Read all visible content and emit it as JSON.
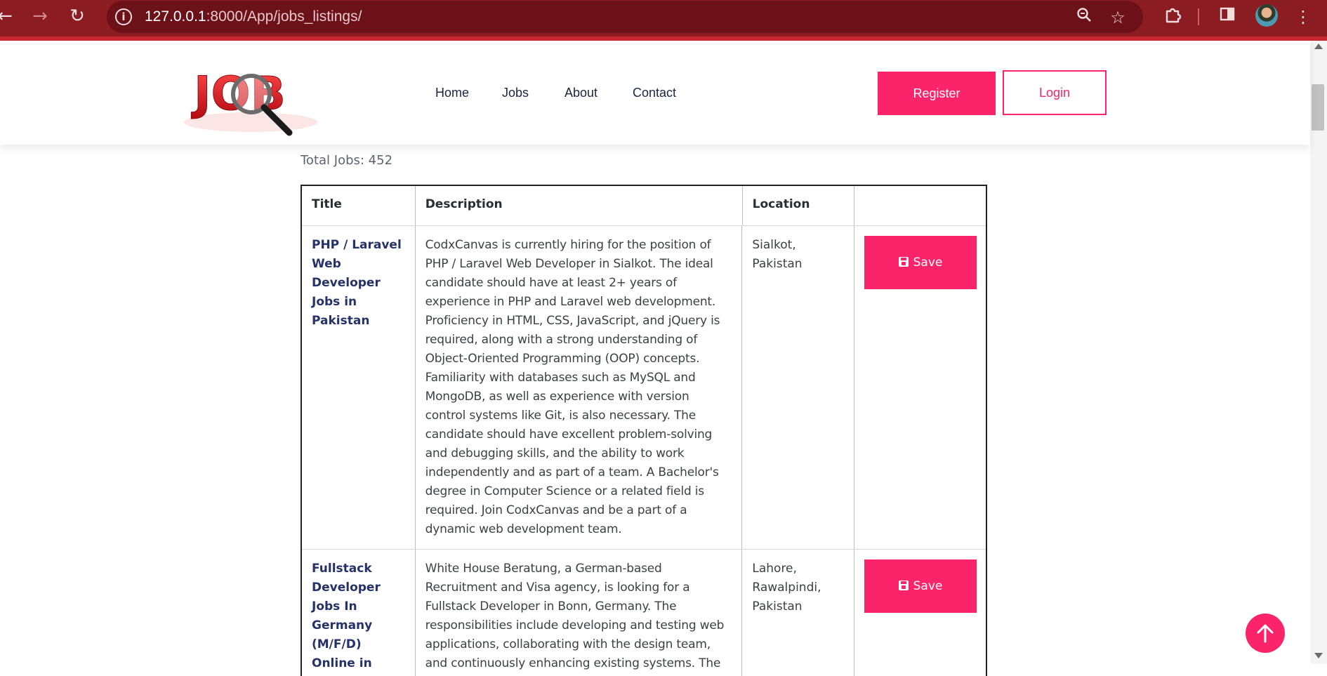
{
  "browser": {
    "url_host": "127.0.0.1",
    "url_path": ":8000/App/jobs_listings/",
    "icons": [
      "back-arrow-icon",
      "forward-arrow-icon",
      "reload-icon",
      "site-info-icon",
      "zoom-icon",
      "bookmark-star-icon",
      "extensions-icon",
      "side-panel-icon",
      "profile-avatar",
      "menu-dots-icon"
    ],
    "theme_color": "#8b1c22"
  },
  "header": {
    "logo_text": "JOB",
    "nav": [
      "Home",
      "Jobs",
      "About",
      "Contact"
    ],
    "register_label": "Register",
    "login_label": "Login",
    "accent_color": "#fb246a"
  },
  "listing": {
    "total_label": "Total Jobs: ",
    "total_count": "452",
    "columns": [
      "Title",
      "Description",
      "Location",
      ""
    ],
    "save_label": "Save",
    "jobs": [
      {
        "title": "PHP / Laravel Web Developer Jobs in Pakistan",
        "description": "CodxCanvas is currently hiring for the position of PHP / Laravel Web Developer in Sialkot. The ideal candidate should have at least 2+ years of experience in PHP and Laravel web development. Proficiency in HTML, CSS, JavaScript, and jQuery is required, along with a strong understanding of Object-Oriented Programming (OOP) concepts. Familiarity with databases such as MySQL and MongoDB, as well as experience with version control systems like Git, is also necessary. The candidate should have excellent problem-solving and debugging skills, and the ability to work independently and as part of a team. A Bachelor's degree in Computer Science or a related field is required. Join CodxCanvas and be a part of a dynamic web development team.",
        "location": "Sialkot, Pakistan"
      },
      {
        "title": "Fullstack Developer Jobs In Germany (M/F/D) Online in Pakistan",
        "description": "White House Beratung, a German-based Recruitment and Visa agency, is looking for a Fullstack Developer in Bonn, Germany. The responsibilities include developing and testing web applications, collaborating with the design team, and continuously enhancing existing systems. The",
        "location": "Lahore, Rawalpindi, Pakistan"
      }
    ]
  }
}
